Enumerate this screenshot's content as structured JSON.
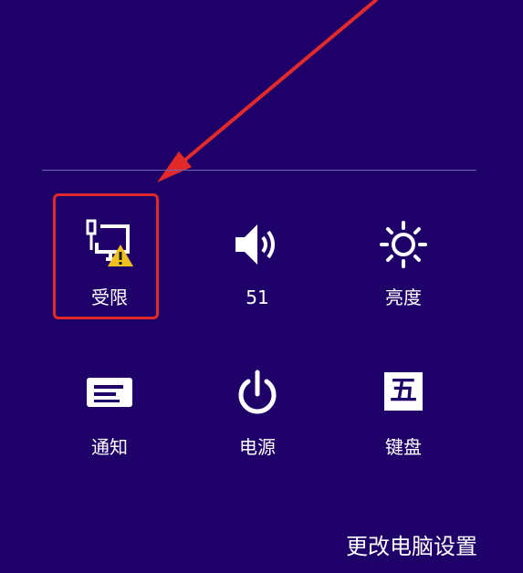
{
  "tiles": {
    "network": {
      "label": "受限",
      "icon": "network-limited-icon"
    },
    "volume": {
      "label": "51",
      "icon": "volume-icon"
    },
    "brightness": {
      "label": "亮度",
      "icon": "brightness-icon"
    },
    "notifications": {
      "label": "通知",
      "icon": "notifications-icon"
    },
    "power": {
      "label": "电源",
      "icon": "power-icon"
    },
    "keyboard": {
      "label": "键盘",
      "icon": "keyboard-icon",
      "glyph": "五"
    }
  },
  "footer": {
    "change_settings": "更改电脑设置"
  },
  "colors": {
    "background": "#1f0068",
    "highlight": "#e22a2a",
    "warning": "#f0c020"
  }
}
